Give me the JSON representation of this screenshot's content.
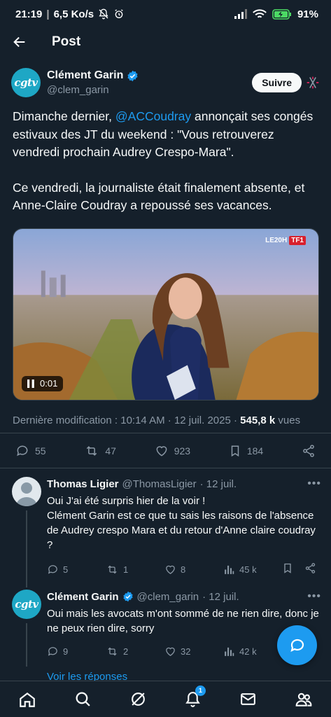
{
  "status": {
    "time": "21:19",
    "speed": "6,5 Ko/s",
    "battery": "91%"
  },
  "header": {
    "title": "Post"
  },
  "post": {
    "author": {
      "avatar_text": "cgtv",
      "name": "Clément Garin",
      "handle": "@clem_garin"
    },
    "follow_label": "Suivre",
    "text_1_before": "Dimanche dernier, ",
    "mention": "@ACCoudray",
    "text_1_after": " annonçait ses congés estivaux des JT du weekend : \"Vous retrouverez vendredi prochain Audrey Crespo-Mara\".",
    "text_2": "Ce vendredi, la journaliste était finalement absente, et Anne-Claire Coudray a repoussé ses vacances.",
    "media": {
      "logo_text": "LE20H",
      "logo_brand": "TF1",
      "duration": "0:01"
    },
    "timestamp_label": "Dernière modification : 10:14 AM · 12 juil. 2025 · ",
    "views_count": "545,8 k",
    "views_label": "vues",
    "stats": {
      "replies": "55",
      "reposts": "47",
      "likes": "923",
      "bookmarks": "184"
    }
  },
  "replies": [
    {
      "name": "Thomas Ligier",
      "handle": "@ThomasLigier",
      "date": "· 12 juil.",
      "text": "Oui J'ai été surpris hier de la voir !\nClément Garin est ce que tu sais les raisons de l'absence de Audrey crespo Mara et du retour d'Anne claire coudray ?",
      "replies": "5",
      "reposts": "1",
      "likes": "8",
      "views": "45 k"
    },
    {
      "name": "Clément Garin",
      "handle": "@clem_garin",
      "date": "· 12 juil.",
      "avatar_text": "cgtv",
      "text": "Oui mais les avocats m'ont sommé de ne rien dire, donc je ne peux rien dire, sorry",
      "replies": "9",
      "reposts": "2",
      "likes": "32",
      "views": "42 k"
    }
  ],
  "see_replies": "Voir les réponses",
  "nav": {
    "notif_count": "1"
  },
  "colors": {
    "bg": "#15202b",
    "accent": "#1d9bf0",
    "muted": "#8b98a5",
    "divider": "#38444d"
  }
}
